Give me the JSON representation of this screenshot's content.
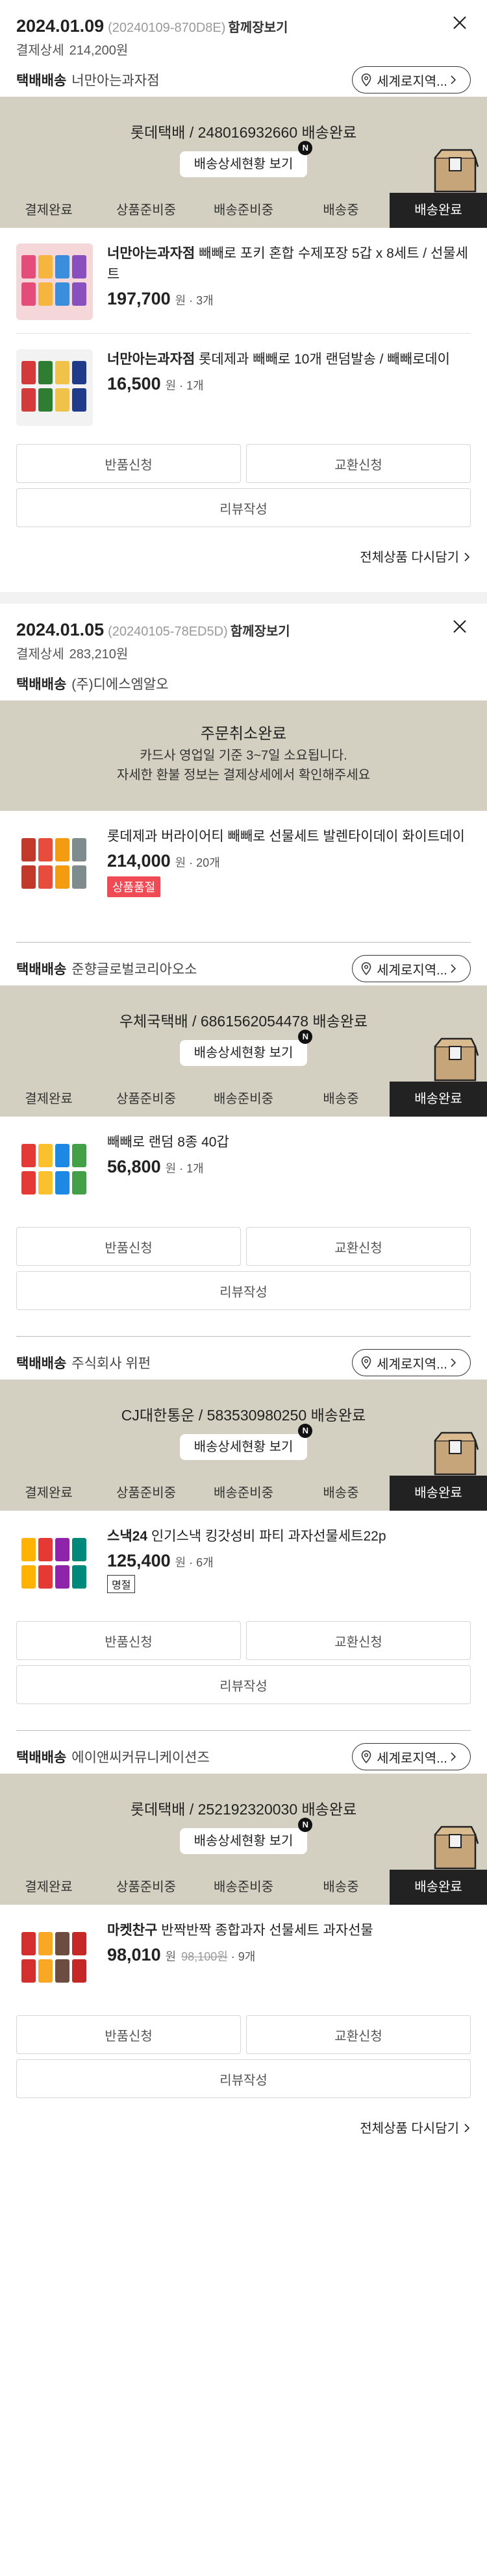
{
  "orders": [
    {
      "date": "2024.01.09",
      "order_no": "(20240109-870D8E)",
      "together": "함께장보기",
      "pay_label": "결제상세",
      "pay_amount": "214,200원",
      "shipments": [
        {
          "type": "택배배송",
          "seller": "너만아는과자점",
          "world_btn": "세계로지역...",
          "tracking": "롯데택배 / 248016932660 배송완료",
          "track_btn": "배송상세현황 보기",
          "badge": "N",
          "steps": [
            "결제완료",
            "상품준비중",
            "배송준비중",
            "배송중",
            "배송완료"
          ],
          "products": [
            {
              "brand": "너만아는과자점",
              "name": "빼빼로 포키 혼합 수제포장 5갑 x 8세트 / 선물세트",
              "price": "197,700",
              "unit": "원",
              "qty": "· 3개"
            },
            {
              "brand": "너만아는과자점",
              "name": "롯데제과 빼빼로 10개 랜덤발송 / 빼빼로데이",
              "price": "16,500",
              "unit": "원",
              "qty": "· 1개"
            }
          ],
          "btn_return": "반품신청",
          "btn_exchange": "교환신청",
          "btn_review": "리뷰작성"
        }
      ],
      "redo": "전체상품 다시담기"
    },
    {
      "date": "2024.01.05",
      "order_no": "(20240105-78ED5D)",
      "together": "함께장보기",
      "pay_label": "결제상세",
      "pay_amount": "283,210원",
      "cancel": {
        "type": "택배배송",
        "seller": "(주)디에스엠알오",
        "title": "주문취소완료",
        "line1": "카드사 영업일 기준 3~7일 소요됩니다.",
        "line2": "자세한 환불 정보는 결제상세에서 확인해주세요",
        "product": {
          "name": "롯데제과 버라이어티 빼빼로 선물세트 발렌타이데이 화이트데이",
          "price": "214,000",
          "unit": "원",
          "qty": "· 20개",
          "tag": "상품품절"
        }
      },
      "shipments": [
        {
          "type": "택배배송",
          "seller": "준향글로벌코리아오소",
          "world_btn": "세계로지역...",
          "tracking": "우체국택배 / 6861562054478 배송완료",
          "track_btn": "배송상세현황 보기",
          "badge": "N",
          "steps": [
            "결제완료",
            "상품준비중",
            "배송준비중",
            "배송중",
            "배송완료"
          ],
          "products": [
            {
              "brand": "",
              "name": "빼빼로 랜덤 8종 40갑",
              "price": "56,800",
              "unit": "원",
              "qty": "· 1개"
            }
          ],
          "btn_return": "반품신청",
          "btn_exchange": "교환신청",
          "btn_review": "리뷰작성"
        },
        {
          "type": "택배배송",
          "seller": "주식회사 위펀",
          "world_btn": "세계로지역...",
          "tracking": "CJ대한통운 / 583530980250 배송완료",
          "track_btn": "배송상세현황 보기",
          "badge": "N",
          "steps": [
            "결제완료",
            "상품준비중",
            "배송준비중",
            "배송중",
            "배송완료"
          ],
          "products": [
            {
              "brand": "스낵24",
              "name": "스낵24 인기스낵 킹갓성비 파티 과자선물세트22p",
              "price": "125,400",
              "unit": "원",
              "qty": "· 6개",
              "tag": "명절"
            }
          ],
          "btn_return": "반품신청",
          "btn_exchange": "교환신청",
          "btn_review": "리뷰작성"
        },
        {
          "type": "택배배송",
          "seller": "에이앤씨커뮤니케이션즈",
          "world_btn": "세계로지역...",
          "tracking": "롯데택배 / 252192320030 배송완료",
          "track_btn": "배송상세현황 보기",
          "badge": "N",
          "steps": [
            "결제완료",
            "상품준비중",
            "배송준비중",
            "배송중",
            "배송완료"
          ],
          "products": [
            {
              "brand": "마켓찬구",
              "name": "반짝반짝 종합과자 선물세트 과자선물",
              "price": "98,010",
              "unit": "원",
              "orig": "98,100원",
              "qty": "· 9개"
            }
          ],
          "btn_return": "반품신청",
          "btn_exchange": "교환신청",
          "btn_review": "리뷰작성"
        }
      ],
      "redo": "전체상품 다시담기"
    }
  ],
  "colors": {
    "panel": "#d4d0c1",
    "active_step": "#222222",
    "sold_out": "#f04a55"
  },
  "icons": [
    "close-icon",
    "location-pin-icon",
    "chevron-right-icon",
    "delivery-box-icon"
  ]
}
